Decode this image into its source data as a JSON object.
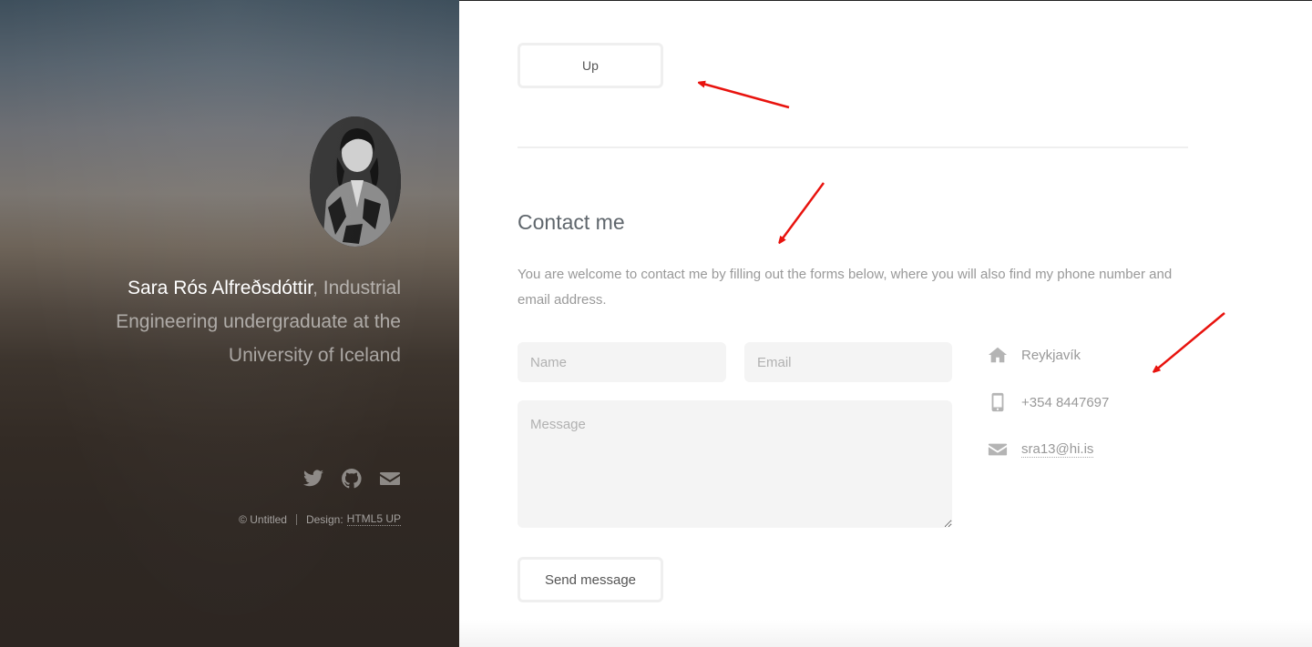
{
  "sidebar": {
    "name": "Sara Rós Alfreðsdóttir",
    "intro_rest": ", Industrial Engineering undergraduate at the University of Iceland",
    "social": [
      {
        "icon": "twitter-icon"
      },
      {
        "icon": "github-icon"
      },
      {
        "icon": "envelope-icon"
      }
    ],
    "copyright": "© Untitled",
    "design_label": "Design:",
    "design_link": "HTML5 UP"
  },
  "main": {
    "up_button": "Up",
    "contact_title": "Contact me",
    "contact_text": "You are welcome to contact me by filling out the forms below, where you will also find my phone number and email address.",
    "form": {
      "name_placeholder": "Name",
      "email_placeholder": "Email",
      "message_placeholder": "Message",
      "send_label": "Send message"
    },
    "info": {
      "city": "Reykjavík",
      "phone": "+354 8447697",
      "email": "sra13@hi.is"
    }
  },
  "annotations": {
    "arrow_color": "#e8130e"
  },
  "colors": {
    "accent_text": "#7f888f",
    "field_background": "#f4f4f4"
  }
}
